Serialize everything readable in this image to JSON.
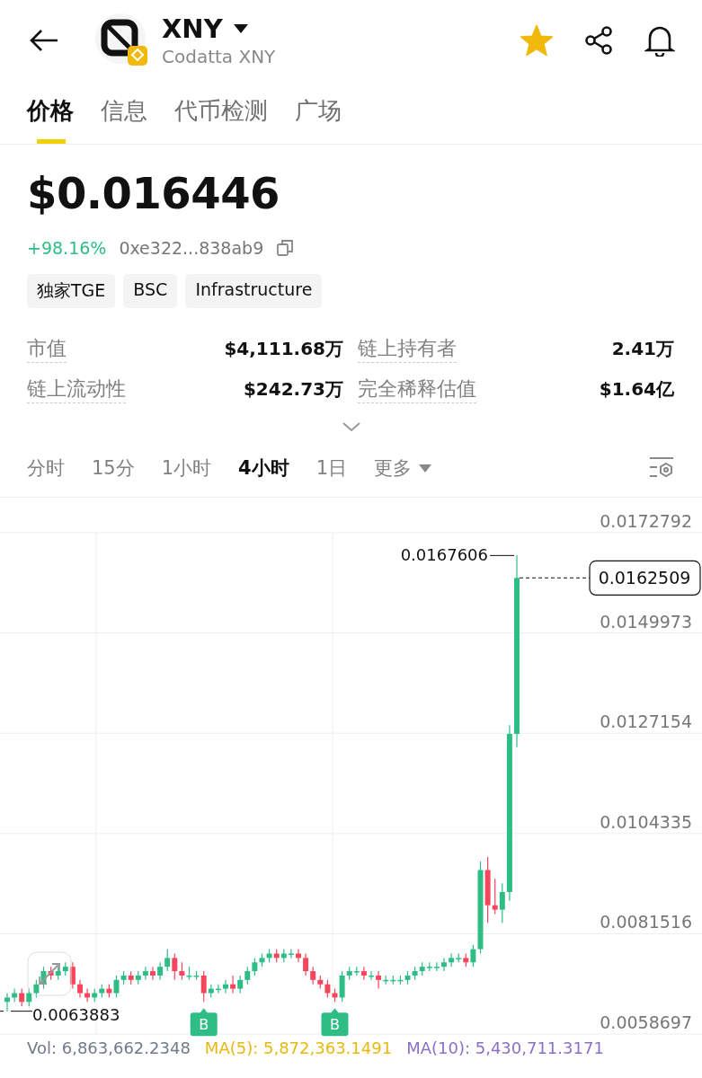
{
  "header": {
    "symbol": "XNY",
    "name": "Codatta XNY",
    "favorite": true
  },
  "tabs": [
    {
      "label": "价格",
      "selected": true
    },
    {
      "label": "信息",
      "selected": false
    },
    {
      "label": "代币检测",
      "selected": false
    },
    {
      "label": "广场",
      "selected": false
    }
  ],
  "price": "$0.016446",
  "change": "+98.16%",
  "address": "0xe322...838ab9",
  "tags": [
    "独家TGE",
    "BSC",
    "Infrastructure"
  ],
  "stats": [
    {
      "label": "市值",
      "value": "$4,111.68万"
    },
    {
      "label": "链上持有者",
      "value": "2.41万"
    },
    {
      "label": "链上流动性",
      "value": "$242.73万"
    },
    {
      "label": "完全稀释估值",
      "value": "$1.64亿"
    }
  ],
  "intervals": [
    {
      "label": "分时",
      "selected": false
    },
    {
      "label": "15分",
      "selected": false
    },
    {
      "label": "1小时",
      "selected": false
    },
    {
      "label": "4小时",
      "selected": true
    },
    {
      "label": "1日",
      "selected": false
    },
    {
      "label": "更多",
      "selected": false,
      "kind": "dropdown"
    }
  ],
  "chart": {
    "chart_data": {
      "type": "candlestick",
      "grid": true,
      "ylim": [
        0.0058697,
        0.0172792
      ],
      "yticks": [
        {
          "value": 0.0172792,
          "label": "0.0172792"
        },
        {
          "value": 0.0149973,
          "label": "0.0149973"
        },
        {
          "value": 0.0127154,
          "label": "0.0127154"
        },
        {
          "value": 0.0104335,
          "label": "0.0104335"
        },
        {
          "value": 0.0081516,
          "label": "0.0081516"
        },
        {
          "value": 0.0058697,
          "label": "0.0058697"
        }
      ],
      "ohlc": [
        [
          0.0066,
          0.0068,
          0.0063883,
          0.0067
        ],
        [
          0.0067,
          0.0069,
          0.0066,
          0.0068
        ],
        [
          0.0068,
          0.0069,
          0.0065,
          0.0066
        ],
        [
          0.0066,
          0.0069,
          0.0065,
          0.0068
        ],
        [
          0.0068,
          0.0071,
          0.0067,
          0.007
        ],
        [
          0.007,
          0.0074,
          0.0069,
          0.0073
        ],
        [
          0.0073,
          0.0074,
          0.0071,
          0.0072
        ],
        [
          0.0072,
          0.0074,
          0.0071,
          0.0073
        ],
        [
          0.0073,
          0.0075,
          0.0072,
          0.0074
        ],
        [
          0.0074,
          0.0075,
          0.0069,
          0.007
        ],
        [
          0.007,
          0.0071,
          0.0067,
          0.0068
        ],
        [
          0.0068,
          0.0069,
          0.0066,
          0.0067
        ],
        [
          0.0067,
          0.0069,
          0.0066,
          0.0068
        ],
        [
          0.0068,
          0.007,
          0.0067,
          0.0069
        ],
        [
          0.0069,
          0.007,
          0.0067,
          0.0068
        ],
        [
          0.0068,
          0.0072,
          0.0067,
          0.0071
        ],
        [
          0.0071,
          0.0073,
          0.007,
          0.0072
        ],
        [
          0.0072,
          0.0073,
          0.007,
          0.0071
        ],
        [
          0.0071,
          0.0073,
          0.007,
          0.0072
        ],
        [
          0.0072,
          0.0074,
          0.0071,
          0.0073
        ],
        [
          0.0073,
          0.0074,
          0.0071,
          0.0072
        ],
        [
          0.0072,
          0.0075,
          0.0071,
          0.0074
        ],
        [
          0.0074,
          0.0078,
          0.0073,
          0.0076
        ],
        [
          0.0076,
          0.0077,
          0.0071,
          0.0073
        ],
        [
          0.0073,
          0.0075,
          0.0071,
          0.0072
        ],
        [
          0.0072,
          0.0074,
          0.0071,
          0.0072
        ],
        [
          0.0072,
          0.0073,
          0.0071,
          0.0072
        ],
        [
          0.0072,
          0.0073,
          0.0066,
          0.0068
        ],
        [
          0.0068,
          0.007,
          0.0067,
          0.0069
        ],
        [
          0.0069,
          0.007,
          0.0068,
          0.0069
        ],
        [
          0.0069,
          0.0071,
          0.0068,
          0.007
        ],
        [
          0.007,
          0.0072,
          0.0068,
          0.0069
        ],
        [
          0.0069,
          0.0072,
          0.0068,
          0.0071
        ],
        [
          0.0071,
          0.0074,
          0.007,
          0.0073
        ],
        [
          0.0073,
          0.0076,
          0.0072,
          0.0075
        ],
        [
          0.0075,
          0.0077,
          0.0074,
          0.0076
        ],
        [
          0.0076,
          0.0078,
          0.0075,
          0.0077
        ],
        [
          0.0077,
          0.0078,
          0.0075,
          0.0076
        ],
        [
          0.0076,
          0.0078,
          0.0075,
          0.0077
        ],
        [
          0.0077,
          0.0078,
          0.0076,
          0.0077
        ],
        [
          0.0077,
          0.0078,
          0.0075,
          0.0076
        ],
        [
          0.0076,
          0.0077,
          0.0072,
          0.0073
        ],
        [
          0.0073,
          0.0074,
          0.007,
          0.0071
        ],
        [
          0.0071,
          0.0072,
          0.0069,
          0.007
        ],
        [
          0.007,
          0.0071,
          0.0067,
          0.0068
        ],
        [
          0.0068,
          0.0069,
          0.0066,
          0.0067
        ],
        [
          0.0067,
          0.0073,
          0.0066,
          0.0072
        ],
        [
          0.0072,
          0.0074,
          0.0071,
          0.0073
        ],
        [
          0.0073,
          0.0074,
          0.0072,
          0.0073
        ],
        [
          0.0073,
          0.0074,
          0.0071,
          0.0072
        ],
        [
          0.0072,
          0.0073,
          0.0071,
          0.0072
        ],
        [
          0.0072,
          0.0073,
          0.0069,
          0.0071
        ],
        [
          0.0071,
          0.0072,
          0.007,
          0.0071
        ],
        [
          0.0071,
          0.0072,
          0.007,
          0.0071
        ],
        [
          0.0071,
          0.0072,
          0.007,
          0.0071
        ],
        [
          0.0071,
          0.0073,
          0.007,
          0.0072
        ],
        [
          0.0072,
          0.0074,
          0.0071,
          0.0073
        ],
        [
          0.0073,
          0.0075,
          0.0072,
          0.0074
        ],
        [
          0.0074,
          0.0075,
          0.0073,
          0.0074
        ],
        [
          0.0074,
          0.0075,
          0.0073,
          0.0074
        ],
        [
          0.0074,
          0.0076,
          0.0073,
          0.0075
        ],
        [
          0.0075,
          0.0077,
          0.0074,
          0.0076
        ],
        [
          0.0076,
          0.0077,
          0.0075,
          0.0076
        ],
        [
          0.0076,
          0.0077,
          0.0074,
          0.0075
        ],
        [
          0.0075,
          0.0079,
          0.0074,
          0.0078
        ],
        [
          0.0078,
          0.0098,
          0.0077,
          0.0096
        ],
        [
          0.0096,
          0.0099,
          0.0084,
          0.0088
        ],
        [
          0.0088,
          0.0094,
          0.0086,
          0.0087
        ],
        [
          0.0087,
          0.0093,
          0.0084,
          0.0091
        ],
        [
          0.0091,
          0.0129,
          0.0089,
          0.0127
        ],
        [
          0.0127,
          0.0167606,
          0.0124,
          0.0162509
        ]
      ],
      "orientation": "vertical"
    },
    "last_price": "0.0162509",
    "extremes": {
      "high": "0.0167606",
      "low": "0.0063883"
    },
    "buy_labels": [
      "B",
      "B"
    ],
    "buy_flags": [
      false,
      false,
      false,
      false,
      false,
      false,
      false,
      false,
      false,
      false,
      false,
      false,
      false,
      false,
      false,
      false,
      false,
      false,
      false,
      false,
      false,
      false,
      false,
      false,
      false,
      false,
      false,
      true,
      false,
      false,
      false,
      false,
      false,
      false,
      false,
      false,
      false,
      false,
      false,
      false,
      false,
      false,
      false,
      false,
      false,
      true,
      false,
      false,
      false,
      false,
      false,
      false,
      false,
      false,
      false,
      false,
      false,
      false,
      false,
      false,
      false,
      false,
      false,
      false,
      false,
      false,
      false,
      false,
      false,
      false,
      false
    ]
  },
  "indicators": [
    {
      "text": "Vol: 6,863,662.2348",
      "color": "#707a8a"
    },
    {
      "text": "MA(5): 5,872,363.1491",
      "color": "#e8b90d"
    },
    {
      "text": "MA(10): 5,430,711.3171",
      "color": "#8c6fc9"
    }
  ]
}
